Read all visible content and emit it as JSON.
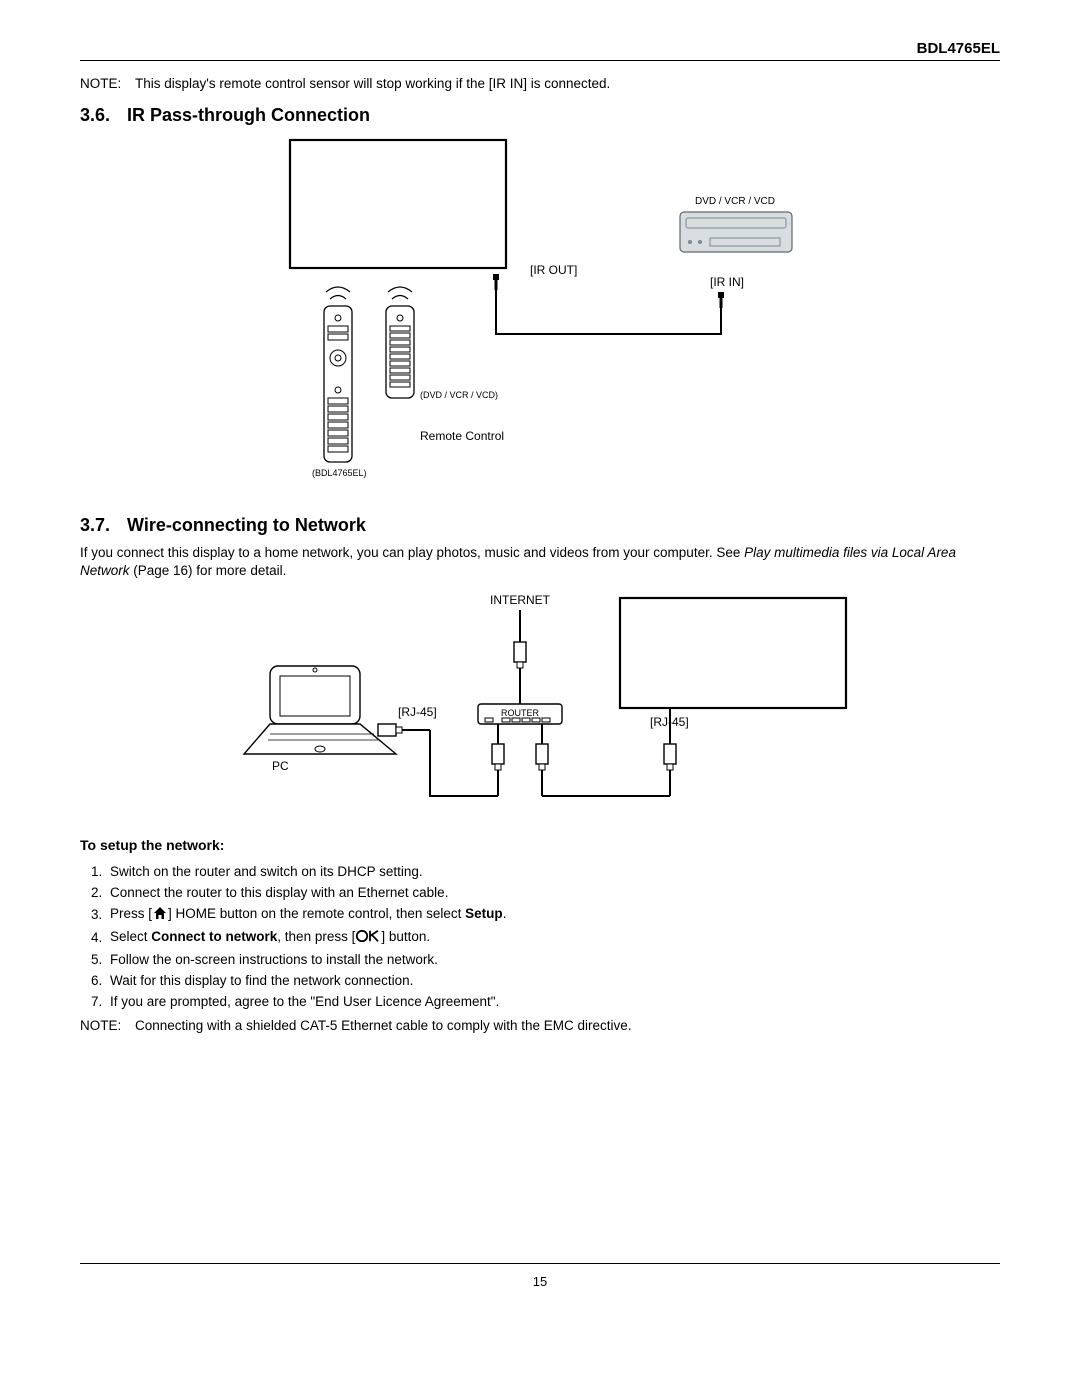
{
  "header": {
    "model": "BDL4765EL"
  },
  "note_top": {
    "label": "NOTE:",
    "text_a": "This display's remote control sensor will stop working if the [",
    "text_b": "IR IN",
    "text_c": "] is connected."
  },
  "sect36": {
    "num": "3.6.",
    "title": "IR Pass-through Connection"
  },
  "fig36": {
    "ir_out": "[IR OUT]",
    "ir_in": "[IR IN]",
    "dvd_label_top": "DVD / VCR / VCD",
    "dvd_label_small": "(DVD / VCR / VCD)",
    "remote_label": "Remote Control",
    "model_small": "(BDL4765EL)"
  },
  "sect37": {
    "num": "3.7.",
    "title": "Wire-connecting to Network"
  },
  "para37_a": "If you connect this display to a home network, you can play photos, music and videos from your computer. See ",
  "para37_b": "Play multimedia files via Local Area Network",
  "para37_c": " (Page 16) for more detail.",
  "fig37": {
    "internet": "INTERNET",
    "router": "ROUTER",
    "rj45_l": "[RJ-45]",
    "rj45_r": "[RJ-45]",
    "pc": "PC"
  },
  "setup_head": "To setup the network:",
  "steps": {
    "s1": "Switch on the router and switch on its DHCP setting.",
    "s2": "Connect the router to this display with an Ethernet cable.",
    "s3a": "Press [",
    "s3b": "] HOME button on the remote control, then select ",
    "s3c": "Setup",
    "s3d": ".",
    "s4a": "Select ",
    "s4b": "Connect to network",
    "s4c": ", then press [",
    "s4d": "] button.",
    "s5": "Follow the on-screen instructions to install the network.",
    "s6": "Wait for this display to find the network connection.",
    "s7a": "If you are prompted, agree to the \"",
    "s7b": "End User Licence Agreement",
    "s7c": "\"."
  },
  "note_bottom": {
    "label": "NOTE:",
    "text": "Connecting with a shielded CAT-5 Ethernet cable to comply with the EMC directive."
  },
  "pagenum": "15"
}
